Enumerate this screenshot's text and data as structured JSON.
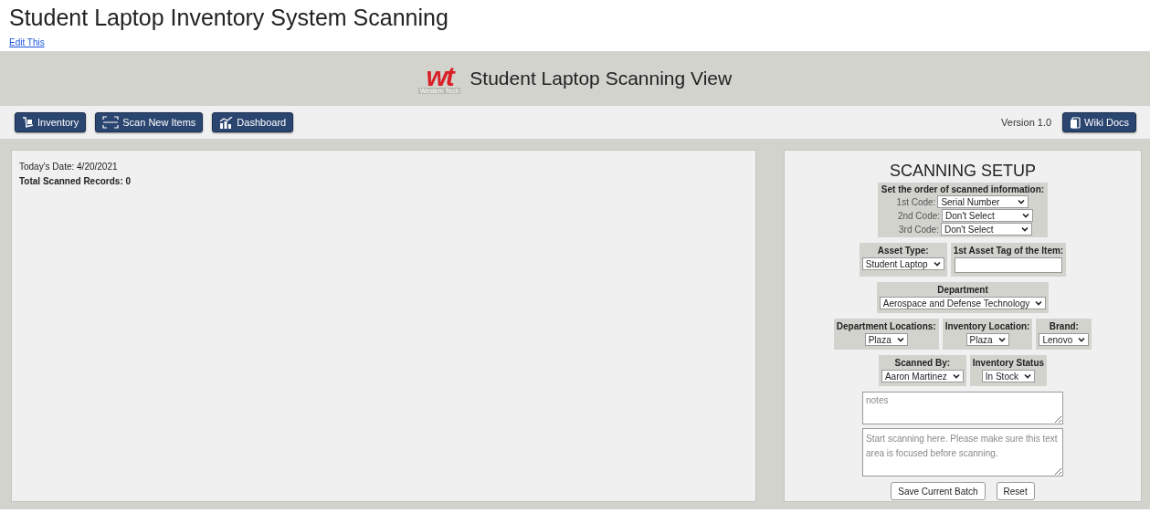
{
  "page_title": "Student Laptop Inventory System Scanning",
  "edit_link": "Edit This",
  "header": {
    "logo_mark": "wt",
    "logo_caption": "Western Tech",
    "title": "Student Laptop Scanning View"
  },
  "toolbar": {
    "buttons": [
      {
        "label": "Inventory",
        "kind": "inventory"
      },
      {
        "label": "Scan New Items",
        "kind": "scan"
      },
      {
        "label": "Dashboard",
        "kind": "dashboard"
      }
    ],
    "version": "Version 1.0",
    "wiki_button": "Wiki Docs"
  },
  "summary": {
    "date_line": "Today's Date: 4/20/2021",
    "total_line": "Total Scanned Records: 0"
  },
  "setup": {
    "title": "SCANNING SETUP",
    "order": {
      "heading": "Set the order of scanned information:",
      "codes": [
        {
          "label": "1st Code:",
          "value": "Serial Number"
        },
        {
          "label": "2nd Code:",
          "value": "Don't Select"
        },
        {
          "label": "3rd Code:",
          "value": "Don't Select"
        }
      ]
    },
    "rows": [
      [
        {
          "label": "Asset Type:",
          "kind": "select",
          "value": "Student Laptop"
        },
        {
          "label": "1st Asset Tag of the Item:",
          "kind": "text"
        }
      ],
      [
        {
          "label": "Department",
          "kind": "select",
          "value": "Aerospace and Defense Technology"
        }
      ],
      [
        {
          "label": "Department Locations:",
          "kind": "select",
          "value": "Plaza"
        },
        {
          "label": "Inventory Location:",
          "kind": "select",
          "value": "Plaza"
        },
        {
          "label": "Brand:",
          "kind": "select",
          "value": "Lenovo"
        }
      ],
      [
        {
          "label": "Scanned By:",
          "kind": "select",
          "value": "Aaron Martinez"
        },
        {
          "label": "Inventory Status",
          "kind": "select",
          "value": "In Stock"
        }
      ]
    ],
    "notes_placeholder": "notes",
    "scan_placeholder": "Start scanning here. Please make sure this text area is focused before scanning.",
    "buttons": [
      "Save Current Batch",
      "Reset"
    ]
  }
}
